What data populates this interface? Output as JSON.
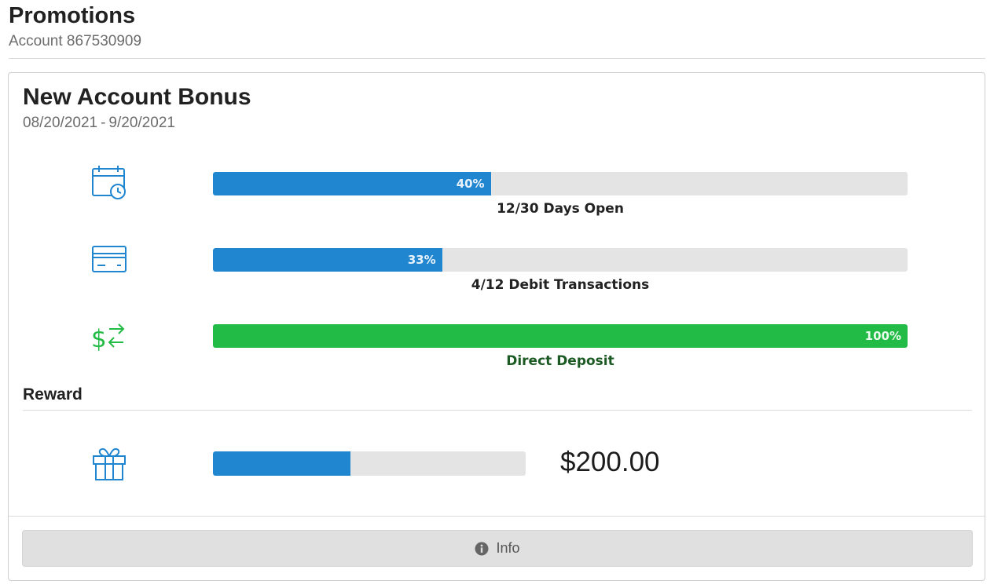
{
  "header": {
    "title": "Promotions",
    "account": "Account 867530909"
  },
  "promotion": {
    "title": "New Account Bonus",
    "start_date": "08/20/2021",
    "date_separator": "-",
    "end_date": "9/20/2021",
    "requirements": [
      {
        "icon": "calendar-clock-icon",
        "progress_percent": 40,
        "progress_label": "40%",
        "caption": "12/30 Days Open",
        "bar_color": "#2186d0",
        "complete": false
      },
      {
        "icon": "credit-card-icon",
        "progress_percent": 33,
        "progress_label": "33%",
        "caption": "4/12 Debit Transactions",
        "bar_color": "#2186d0",
        "complete": false
      },
      {
        "icon": "dollar-transfer-icon",
        "progress_percent": 100,
        "progress_label": "100%",
        "caption": "Direct Deposit",
        "bar_color": "#22bb45",
        "complete": true
      }
    ],
    "reward": {
      "heading": "Reward",
      "icon": "gift-icon",
      "progress_percent": 44,
      "amount": "$200.00"
    },
    "info_button": {
      "icon": "info-icon",
      "label": "Info"
    }
  },
  "colors": {
    "accent_blue": "#2186d0",
    "success_green": "#22bb45",
    "success_text": "#1c5a24",
    "track_gray": "#e4e4e4"
  }
}
